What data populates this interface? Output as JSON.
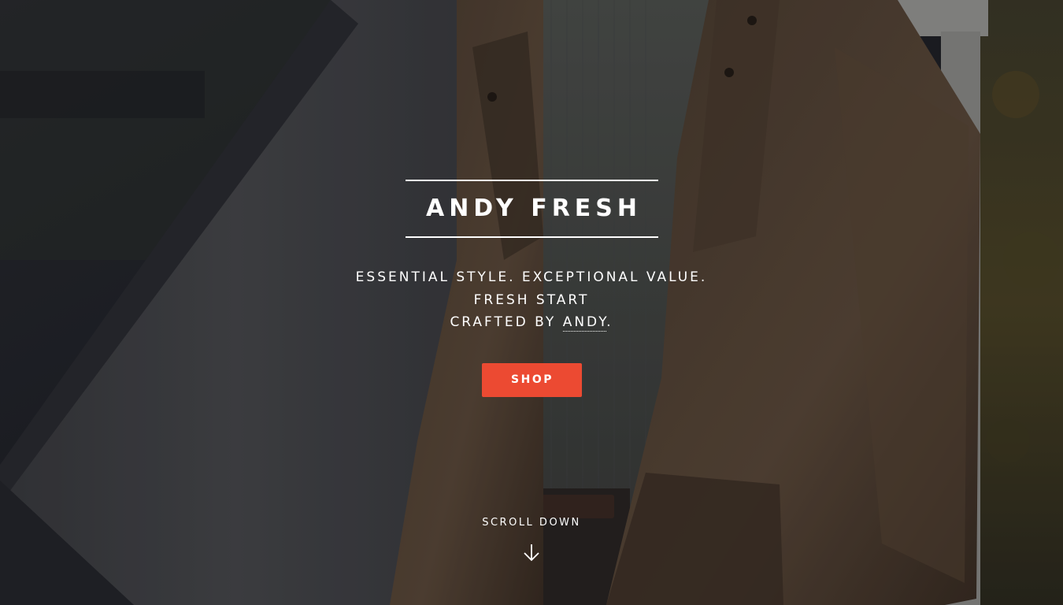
{
  "hero": {
    "brand": "ANDY FRESH",
    "tagline_line1": "ESSENTIAL STYLE. EXCEPTIONAL VALUE.",
    "tagline_line2": "FRESH START",
    "tagline_line3_prefix": "CRAFTED BY ",
    "tagline_line3_link": "ANDY",
    "tagline_line3_suffix": ".",
    "shop_label": "SHOP",
    "scroll_label": "SCROLL DOWN",
    "scroll_icon": "arrow-down-icon",
    "background_image": "man-in-brown-jacket-photo"
  },
  "colors": {
    "accent": "#ec4a32",
    "text": "#ffffff"
  }
}
